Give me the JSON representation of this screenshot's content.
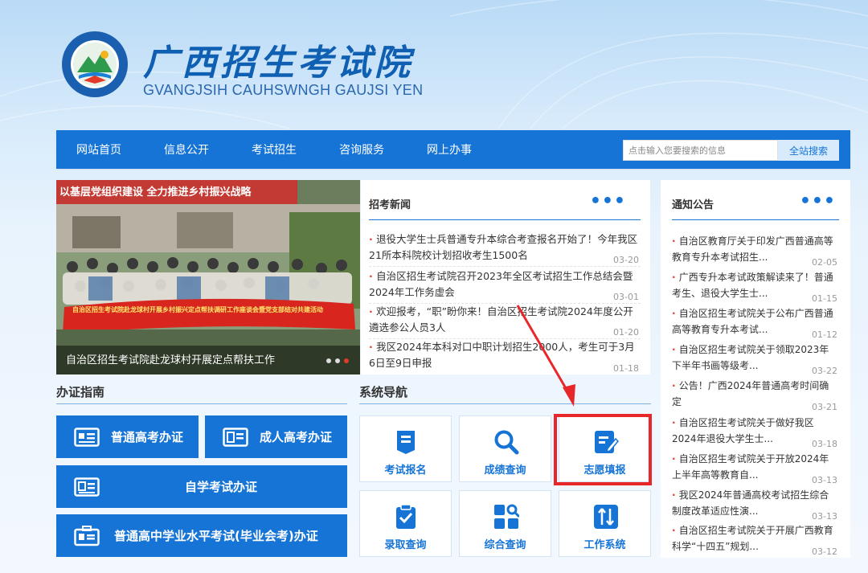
{
  "header": {
    "site_name": "广西招生考试院",
    "site_subtitle": "GVANGJSIH CAUHSWNGH GAUJSI YEN",
    "logo_icon": "logo-icon"
  },
  "nav": {
    "items": [
      "网站首页",
      "信息公开",
      "考试招生",
      "咨询服务",
      "网上办事"
    ],
    "search_placeholder": "点击输入您要搜索的信息",
    "search_button": "全站搜索"
  },
  "carousel": {
    "caption": "自治区招生考试院赴龙球村开展定点帮扶工作",
    "banner_text": "自治区招生考试院赴龙球村开展乡村振兴定点帮扶调研工作座谈会暨党支部结对共建活动",
    "wall_text": "以基层党组织建设 全力推进乡村振兴战略",
    "dots": 3,
    "active_dot": 3
  },
  "news": {
    "title": "招考新闻",
    "more": "•••",
    "items": [
      {
        "text": "退役大学生士兵普通专升本综合考查报名开始了！今年我区21所本科院校计划招收考生1500名",
        "date": "03-20"
      },
      {
        "text": "自治区招生考试院召开2023年全区考试招生工作总结会暨2024年工作务虚会",
        "date": "03-01"
      },
      {
        "text": "欢迎报考，“职”盼你来！自治区招生考试院2024年度公开遴选参公人员3人",
        "date": "01-20"
      },
      {
        "text": "我区2024年本科对口中职计划招生2000人，考生可于3月6日至9日申报",
        "date": "01-18"
      }
    ]
  },
  "notice": {
    "title": "通知公告",
    "more": "•••",
    "items": [
      {
        "text": "自治区教育厅关于印发广西普通高等教育专升本考试招生...",
        "date": "02-05"
      },
      {
        "text": "广西专升本考试政策解读来了！普通考生、退役大学生士...",
        "date": "01-15"
      },
      {
        "text": "自治区招生考试院关于公布广西普通高等教育专升本考试...",
        "date": "01-12"
      },
      {
        "text": "自治区招生考试院关于领取2023年下半年书画等级考...",
        "date": "03-22"
      },
      {
        "text": "公告！广西2024年普通高考时间确定",
        "date": "03-21"
      },
      {
        "text": "自治区招生考试院关于做好我区2024年退役大学生士...",
        "date": "03-18"
      },
      {
        "text": "自治区招生考试院关于开放2024年上半年高等教育自...",
        "date": "03-13"
      },
      {
        "text": "我区2024年普通高校考试招生综合制度改革适应性演...",
        "date": "03-13"
      },
      {
        "text": "自治区招生考试院关于开展广西教育科学“十四五”规划...",
        "date": "03-12"
      }
    ]
  },
  "guide": {
    "title": "办证指南",
    "buttons": [
      "普通高考办证",
      "成人高考办证",
      "自学考试办证",
      "普通高中学业水平考试(毕业会考)办证"
    ]
  },
  "system": {
    "title": "系统导航",
    "tiles": [
      "考试报名",
      "成绩查询",
      "志愿填报",
      "录取查询",
      "综合查询",
      "工作系统"
    ]
  },
  "colors": {
    "primary": "#1674d6",
    "highlight": "#e8272b",
    "accent_dot": "#e23b2b"
  }
}
